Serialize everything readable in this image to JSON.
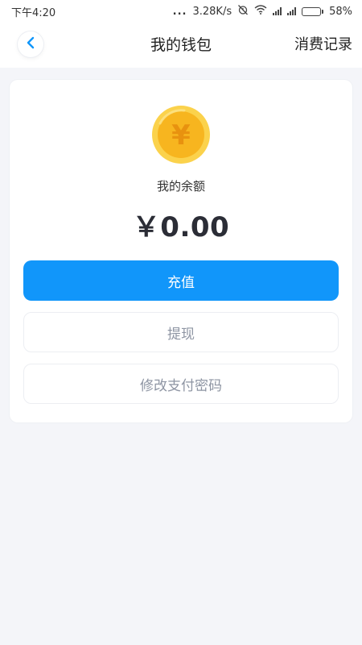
{
  "status_bar": {
    "time": "下午4:20",
    "dots": "...",
    "speed": "3.28K/s",
    "battery": "58%",
    "battery_level": 0.58
  },
  "nav": {
    "back_icon": "chevron-left-icon",
    "title": "我的钱包",
    "right_link": "消费记录"
  },
  "wallet": {
    "coin_icon": "yuan-coin-icon",
    "balance_label": "我的余额",
    "balance_amount": "￥0.00"
  },
  "actions": {
    "recharge": "充值",
    "withdraw": "提现",
    "change_pay_password": "修改支付密码"
  },
  "colors": {
    "primary": "#1196fa",
    "background": "#f4f5f9",
    "coin": "#f9b824"
  }
}
